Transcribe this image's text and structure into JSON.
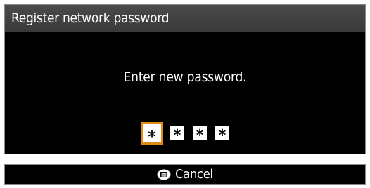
{
  "dialog": {
    "title": "Register network password",
    "prompt": "Enter new password."
  },
  "password": {
    "digits": [
      "*",
      "*",
      "*",
      "*"
    ],
    "selected_index": 0,
    "highlight_color": "#e08a12"
  },
  "footer": {
    "cancel_icon": "menu-button-icon",
    "cancel_label": "Cancel"
  }
}
